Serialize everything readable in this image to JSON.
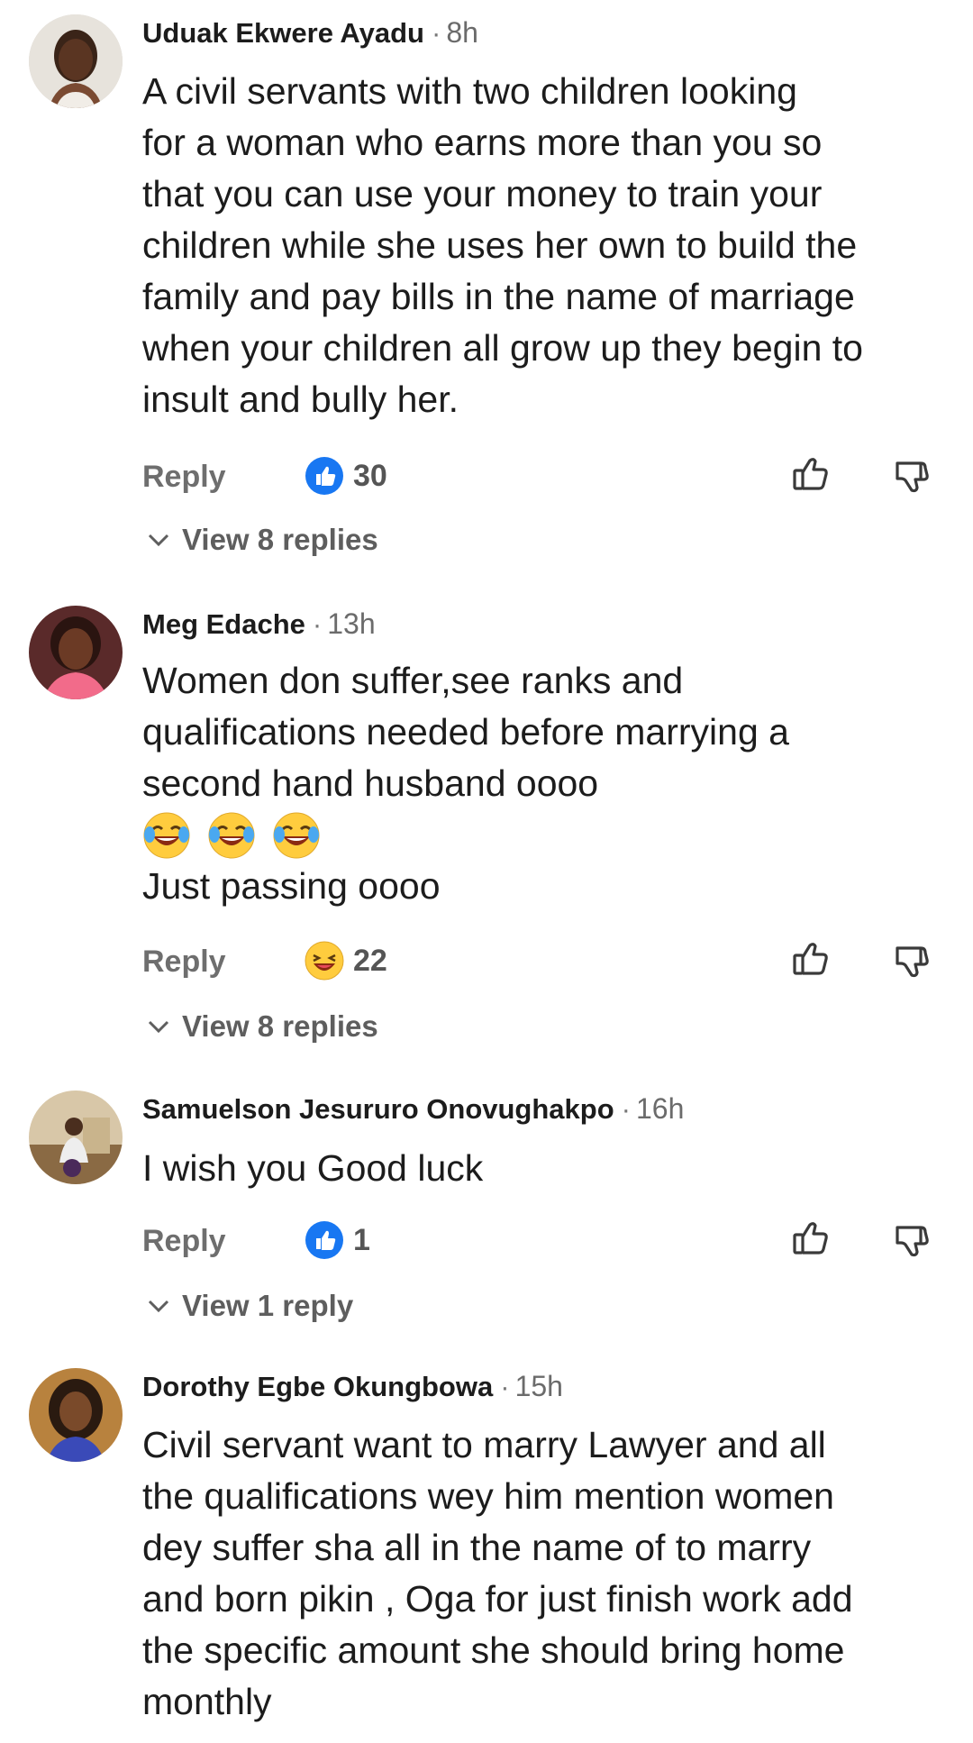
{
  "comments": [
    {
      "author": "Uduak Ekwere Ayadu",
      "separator": "·",
      "time": "8h",
      "lines": [
        "A civil servants with two children looking",
        "for a woman who earns more than you so",
        "that you can use your money to train your",
        "children while she uses her own to build the",
        "family and pay bills in the name of marriage",
        "when your children all grow up they begin to",
        "insult and bully her."
      ],
      "reply_label": "Reply",
      "reaction_icon": "like-reaction-icon",
      "reaction_count": "30",
      "view_replies": "View 8 replies"
    },
    {
      "author": "Meg Edache",
      "separator": "·",
      "time": "13h",
      "lines": [
        "Women don suffer,see ranks and",
        "qualifications needed before marrying a",
        "second hand husband oooo"
      ],
      "emoji": [
        "tears-of-joy-emoji",
        "tears-of-joy-emoji",
        "tears-of-joy-emoji"
      ],
      "extra_line": "Just passing oooo",
      "reply_label": "Reply",
      "reaction_icon": "haha-reaction-icon",
      "reaction_count": "22",
      "view_replies": "View 8 replies"
    },
    {
      "author": "Samuelson Jesururo Onovughakpo",
      "separator": "·",
      "time": "16h",
      "lines": [
        "I wish you Good luck"
      ],
      "reply_label": "Reply",
      "reaction_icon": "like-reaction-icon",
      "reaction_count": "1",
      "view_replies": "View 1 reply"
    },
    {
      "author": "Dorothy Egbe Okungbowa",
      "separator": "·",
      "time": "15h",
      "lines": [
        "Civil servant want to marry Lawyer and all",
        "the qualifications wey him mention women",
        "dey suffer sha all in the name of to marry",
        "and born pikin , Oga for just finish work add",
        "the specific amount she should bring home",
        "monthly"
      ]
    }
  ],
  "colors": {
    "like_blue": "#1877F2",
    "text": "#1c1c1c",
    "muted": "#6e6e6e",
    "emoji_yellow": "#FFCC3E"
  }
}
